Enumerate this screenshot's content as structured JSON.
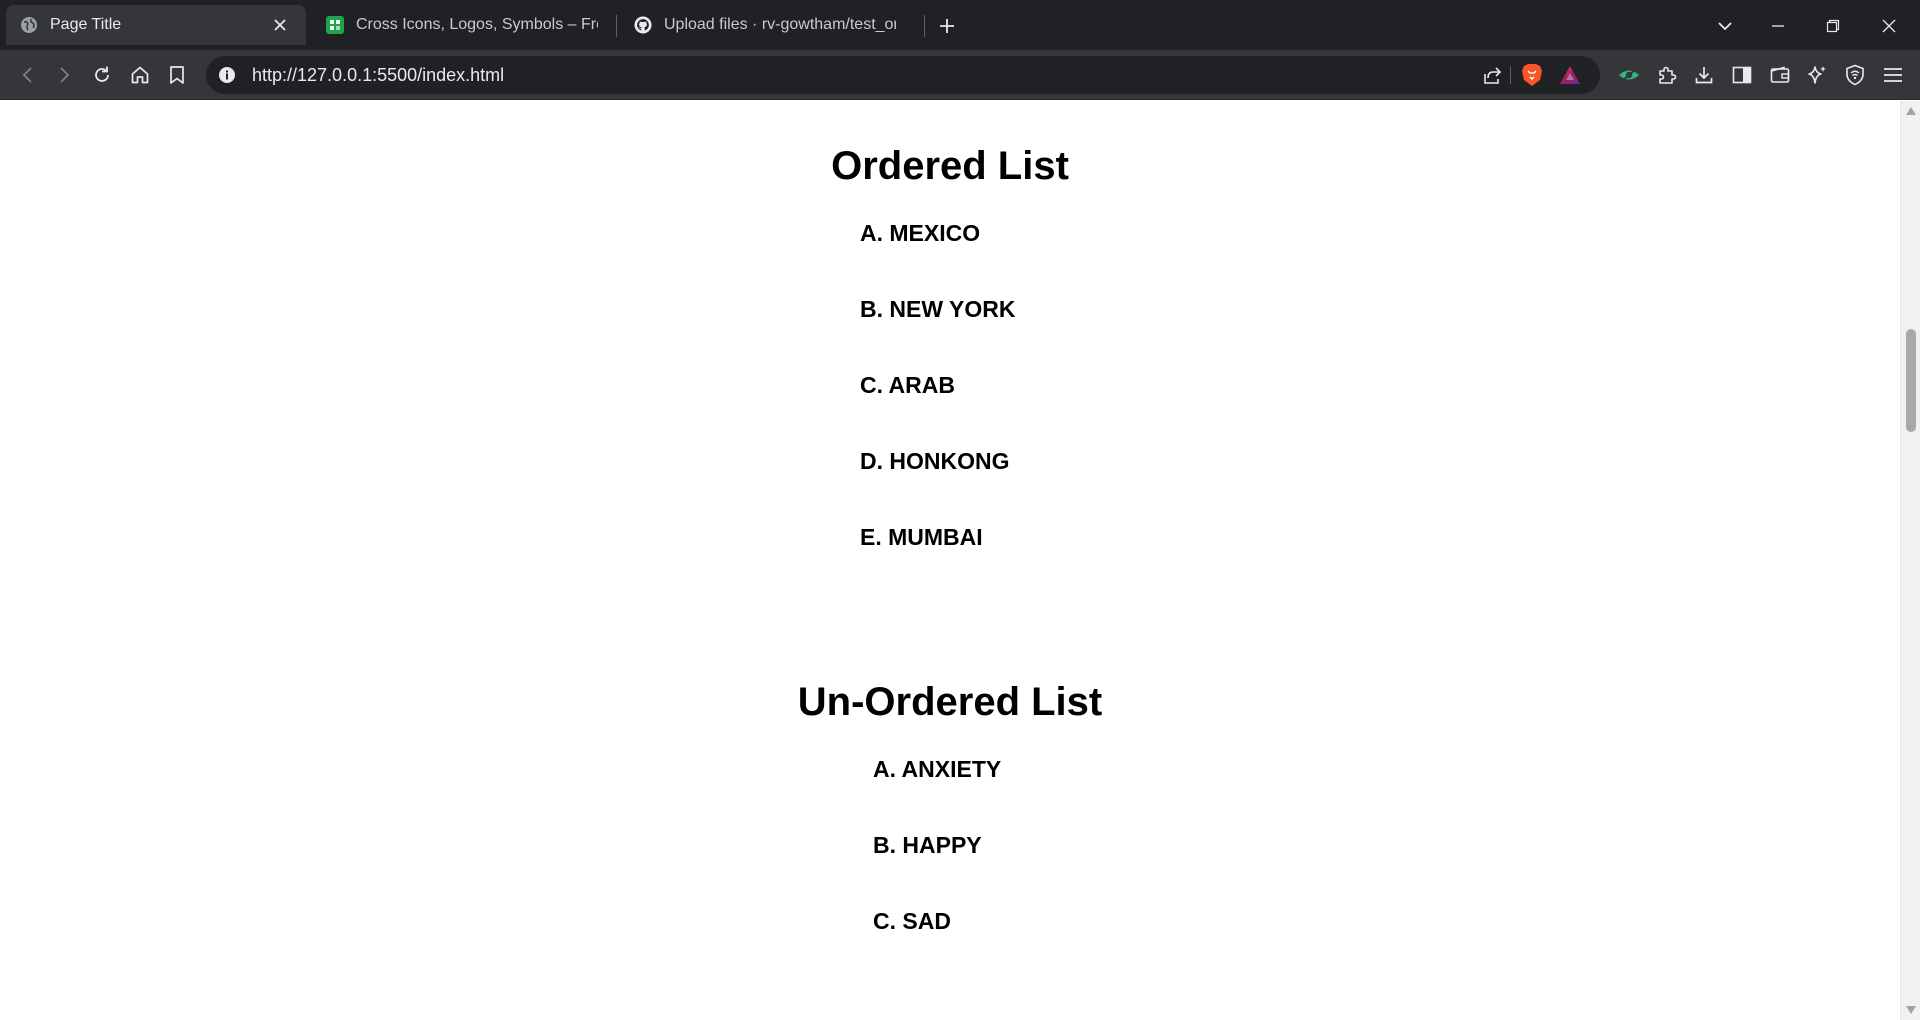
{
  "browser": {
    "tabs": [
      {
        "title": "Page Title",
        "icon": "globe-icon",
        "active": true
      },
      {
        "title": "Cross Icons, Logos, Symbols – Free Do",
        "icon": "green-square-logo-icon",
        "active": false
      },
      {
        "title": "Upload files · rv-gowtham/test_one",
        "icon": "github-icon",
        "active": false
      }
    ],
    "address_bar": {
      "url": "http://127.0.0.1:5500/index.html"
    },
    "colors": {
      "tab_strip": "#202124",
      "toolbar": "#35363a",
      "omnibox": "#202124",
      "brave_orange": "#fb542b",
      "rewards_gradient": "#ff4724",
      "extension_green": "#36b37e"
    }
  },
  "page": {
    "ordered_list": {
      "heading": "Ordered List",
      "items": [
        {
          "marker": "A.",
          "text": "MEXICO"
        },
        {
          "marker": "B.",
          "text": "NEW YORK"
        },
        {
          "marker": "C.",
          "text": "ARAB"
        },
        {
          "marker": "D.",
          "text": "HONKONG"
        },
        {
          "marker": "E.",
          "text": "MUMBAI"
        }
      ]
    },
    "unordered_list": {
      "heading": "Un-Ordered List",
      "items": [
        {
          "marker": "A.",
          "text": "ANXIETY"
        },
        {
          "marker": "B.",
          "text": "HAPPY"
        },
        {
          "marker": "C.",
          "text": "SAD"
        }
      ]
    }
  }
}
